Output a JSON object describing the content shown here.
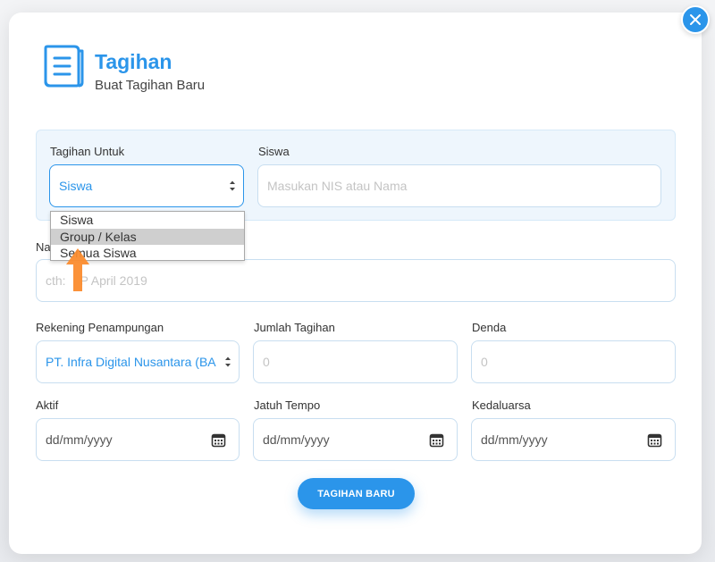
{
  "header": {
    "title": "Tagihan",
    "subtitle": "Buat Tagihan Baru",
    "icon": "document-list-icon"
  },
  "colors": {
    "accent": "#2b95ea",
    "panel_bg": "#eef6fd",
    "arrow": "#fb8c2e"
  },
  "form": {
    "tagihan_untuk": {
      "label": "Tagihan Untuk",
      "value": "Siswa",
      "options": [
        "Siswa",
        "Group / Kelas",
        "Semua Siswa"
      ],
      "highlighted_option": "Group / Kelas"
    },
    "siswa": {
      "label": "Siswa",
      "placeholder": "Masukan NIS atau Nama"
    },
    "nama": {
      "label_visible": "Na",
      "placeholder_visible": "cth: ",
      "placeholder_tail": "P April 2019"
    },
    "rekening": {
      "label": "Rekening Penampungan",
      "value": "PT. Infra Digital Nusantara (BA"
    },
    "jumlah": {
      "label": "Jumlah Tagihan",
      "placeholder": "0"
    },
    "denda": {
      "label": "Denda",
      "placeholder": "0"
    },
    "aktif": {
      "label": "Aktif",
      "placeholder": "dd/mm/yyyy"
    },
    "jatuh_tempo": {
      "label": "Jatuh Tempo",
      "placeholder": "dd/mm/yyyy"
    },
    "kedaluarsa": {
      "label": "Kedaluarsa",
      "placeholder": "dd/mm/yyyy"
    },
    "submit_label": "TAGIHAN BARU"
  }
}
